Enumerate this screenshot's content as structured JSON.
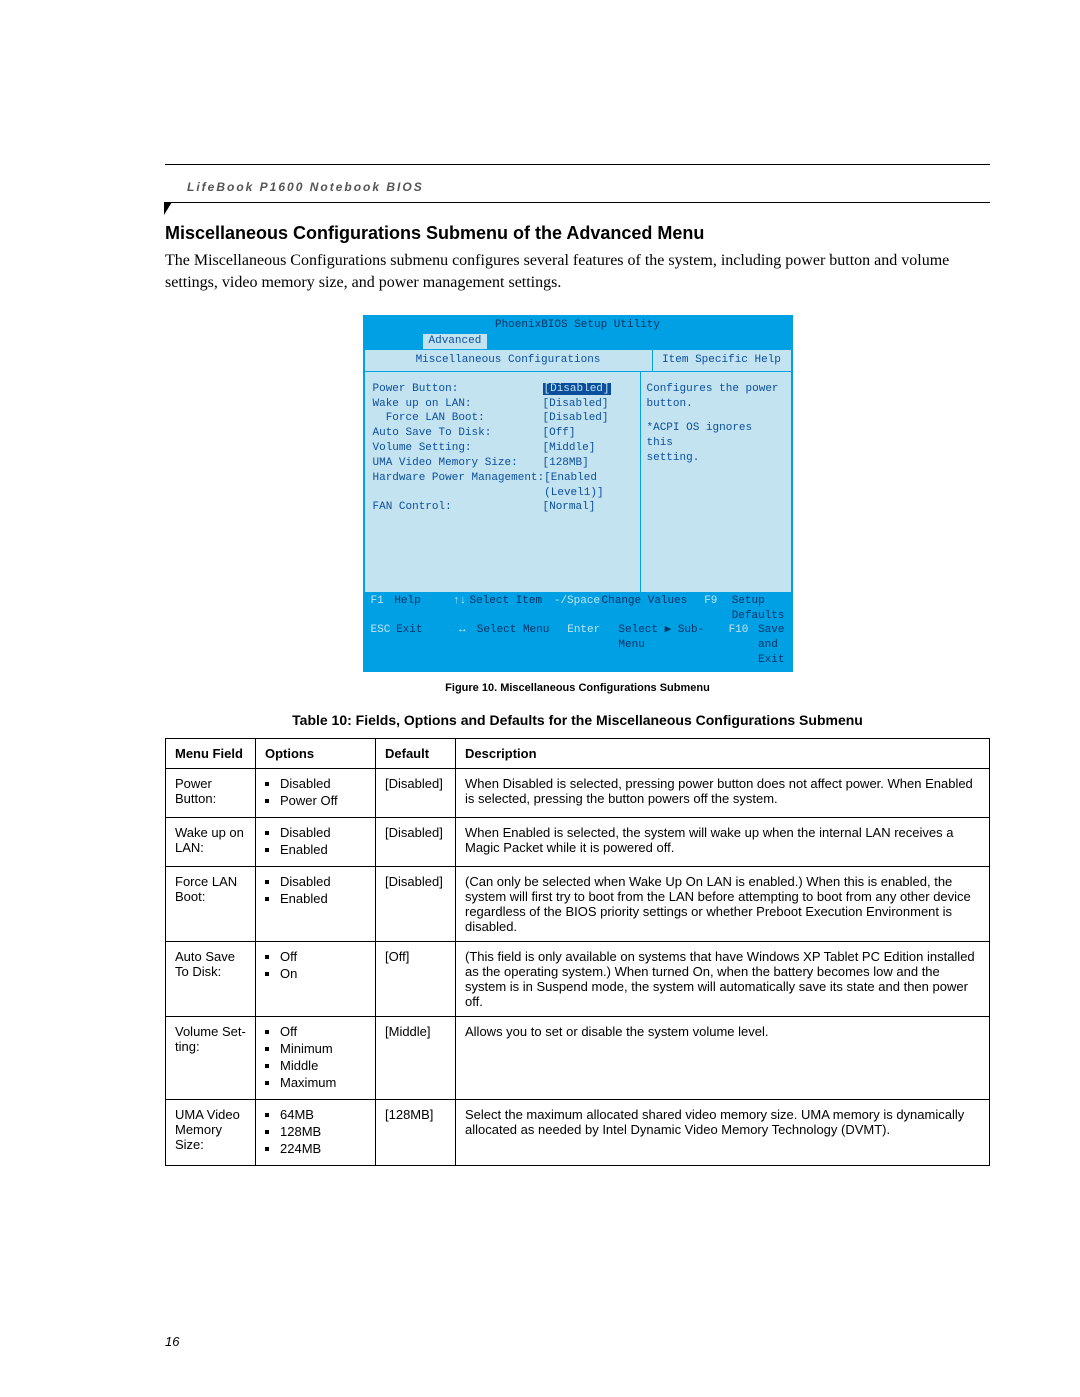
{
  "doc": {
    "running_head": "LifeBook P1600 Notebook BIOS",
    "section_title": "Miscellaneous Configurations Submenu of the Advanced Menu",
    "intro": "The Miscellaneous Configurations submenu configures several features of the system, including power button and volume settings, video memory size, and power management settings.",
    "fig_caption": "Figure 10.  Miscellaneous Configurations Submenu",
    "table_caption": "Table 10: Fields, Options and Defaults for the Miscellaneous Configurations Submenu",
    "page_number": "16"
  },
  "bios": {
    "titlebar": "PhoenixBIOS Setup Utility",
    "tab": "Advanced",
    "subhead_left": "Miscellaneous Configurations",
    "subhead_right": "Item Specific Help",
    "help_line1": "Configures the power",
    "help_line2": "button.",
    "help_line3": "*ACPI OS ignores this",
    "help_line4": "setting.",
    "rows": [
      {
        "label": "Power Button:",
        "value": "[Disabled]",
        "highlight": true
      },
      {
        "label": "Wake up on LAN:",
        "value": "[Disabled]"
      },
      {
        "label": "  Force LAN Boot:",
        "value": "[Disabled]"
      },
      {
        "label": "Auto Save To Disk:",
        "value": "[Off]"
      },
      {
        "label": "Volume Setting:",
        "value": "[Middle]"
      },
      {
        "label": "UMA Video Memory Size:",
        "value": "[128MB]"
      },
      {
        "label": "Hardware Power Management:",
        "value": "[Enabled (Level1)]"
      },
      {
        "label": "FAN Control:",
        "value": "[Normal]"
      }
    ],
    "footer": {
      "r1": {
        "k1": "F1",
        "l1": "Help",
        "k2": "↑↓",
        "l2": "Select Item",
        "k3": "-/Space",
        "l3": "Change Values",
        "k4": "F9",
        "l4": "Setup Defaults"
      },
      "r2": {
        "k1": "ESC",
        "l1": "Exit",
        "k2": "↔",
        "l2": "Select Menu",
        "k3": "Enter",
        "l3": "Select ▶ Sub-Menu",
        "k4": "F10",
        "l4": "Save and Exit"
      }
    }
  },
  "table": {
    "headers": {
      "field": "Menu Field",
      "options": "Options",
      "default": "Default",
      "desc": "Description"
    },
    "rows": [
      {
        "field": "Power Button:",
        "options": [
          "Disabled",
          "Power Off"
        ],
        "default": "[Disabled]",
        "desc": "When Disabled is selected, pressing power button does not affect power. When Enabled is selected, pressing the button powers off the system."
      },
      {
        "field": "Wake up on LAN:",
        "options": [
          "Disabled",
          "Enabled"
        ],
        "default": "[Disabled]",
        "desc": "When Enabled is selected, the system will wake up when the internal LAN receives a Magic Packet while it is powered off."
      },
      {
        "field": "Force LAN Boot:",
        "options": [
          "Disabled",
          "Enabled"
        ],
        "default": "[Disabled]",
        "desc": "(Can only be selected when Wake Up On LAN is enabled.) When this is enabled, the system will first try to boot from the LAN before attempting to boot from any other device regardless of the BIOS priority settings or whether Preboot Execution Environment is disabled."
      },
      {
        "field": "Auto Save To Disk:",
        "options": [
          "Off",
          "On"
        ],
        "default": "[Off]",
        "desc": "(This field is only available on systems that have Windows XP Tablet PC Edition  installed as the operating system.) When turned On, when the battery becomes low and the system is in Suspend mode, the system will automatically save its state and then power off."
      },
      {
        "field": "Volume Set-ting:",
        "options": [
          "Off",
          "Minimum",
          "Middle",
          "Maximum"
        ],
        "default": "[Middle]",
        "desc": "Allows you to set or disable the system volume level."
      },
      {
        "field": "UMA Video Memory Size:",
        "options": [
          "64MB",
          "128MB",
          "224MB"
        ],
        "default": "[128MB]",
        "desc": "Select the maximum allocated shared video memory size. UMA memory is dynamically allocated as needed by Intel Dynamic Video Memory Technology (DVMT)."
      }
    ]
  }
}
